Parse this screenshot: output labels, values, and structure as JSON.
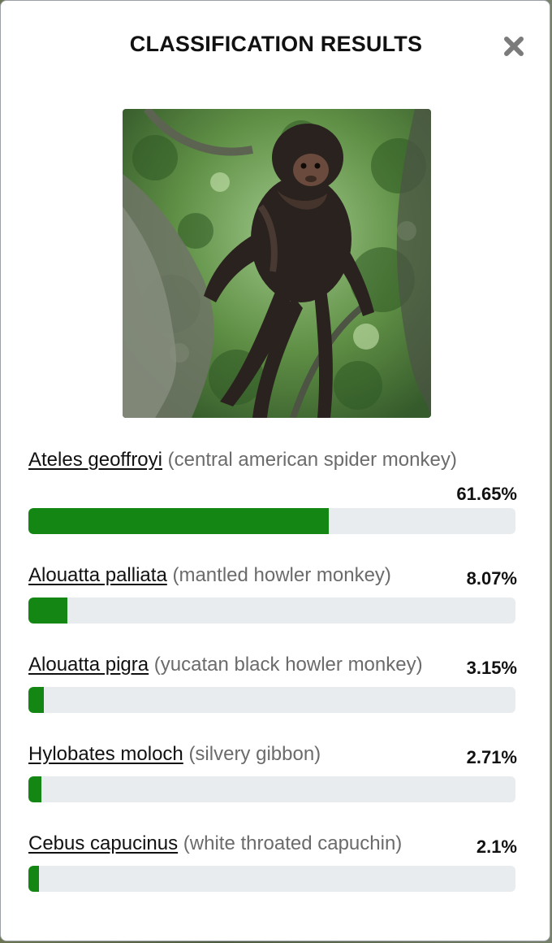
{
  "modal": {
    "title": "CLASSIFICATION RESULTS",
    "close_icon": "close-icon"
  },
  "colors": {
    "bar_fill": "#138613",
    "bar_track": "#e9ecef"
  },
  "results": [
    {
      "scientific": "Ateles geoffroyi",
      "common": "(central american spider monkey)",
      "percent": "61.65%",
      "value": 61.65
    },
    {
      "scientific": "Alouatta palliata",
      "common": "(mantled howler monkey)",
      "percent": "8.07%",
      "value": 8.07
    },
    {
      "scientific": "Alouatta pigra",
      "common": "(yucatan black howler monkey)",
      "percent": "3.15%",
      "value": 3.15
    },
    {
      "scientific": "Hylobates moloch",
      "common": "(silvery gibbon)",
      "percent": "2.71%",
      "value": 2.71
    },
    {
      "scientific": "Cebus capucinus",
      "common": "(white throated capuchin)",
      "percent": "2.1%",
      "value": 2.1
    }
  ]
}
